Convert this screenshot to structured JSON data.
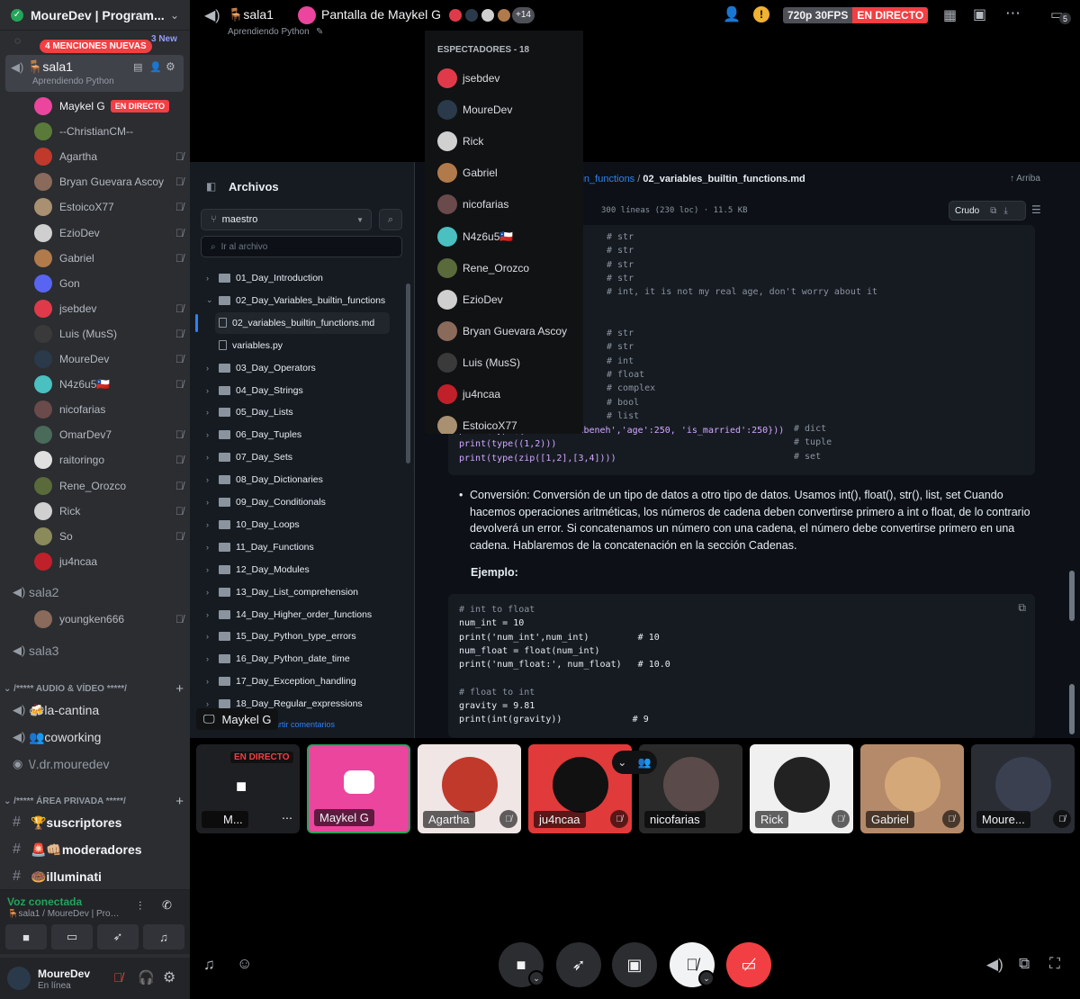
{
  "sidebar": {
    "server_name": "MoureDev | Program...",
    "mentions_badge": "4 MENCIONES NUEVAS",
    "new_badge": "3 New",
    "voice_channel": {
      "name": "sala1",
      "topic": "Aprendiendo Python"
    },
    "live_label": "EN DIRECTO",
    "users": [
      {
        "name": "Maykel G",
        "color": "#eb459e",
        "live": true,
        "muted": false
      },
      {
        "name": "--ChristianCM--",
        "color": "#5a7a3a",
        "live": false,
        "muted": false
      },
      {
        "name": "Agartha",
        "color": "#c0392b",
        "live": false,
        "muted": true
      },
      {
        "name": "Bryan Guevara Ascoy",
        "color": "#8a6a5a",
        "live": false,
        "muted": true
      },
      {
        "name": "EstoicoX77",
        "color": "#a89070",
        "live": false,
        "muted": true
      },
      {
        "name": "EzioDev",
        "color": "#cfcfcf",
        "live": false,
        "muted": true
      },
      {
        "name": "Gabriel",
        "color": "#b07a4a",
        "live": false,
        "muted": true
      },
      {
        "name": "Gon",
        "color": "#5865f2",
        "live": false,
        "muted": false
      },
      {
        "name": "jsebdev",
        "color": "#e03a4a",
        "live": false,
        "muted": true
      },
      {
        "name": "Luis (MusS)",
        "color": "#3a3a3a",
        "live": false,
        "muted": true
      },
      {
        "name": "MoureDev",
        "color": "#2a3a4a",
        "live": false,
        "muted": true
      },
      {
        "name": "N4z6u5🇨🇱",
        "color": "#4ac0c0",
        "live": false,
        "muted": true
      },
      {
        "name": "nicofarias",
        "color": "#6a4a4a",
        "live": false,
        "muted": false
      },
      {
        "name": "OmarDev7",
        "color": "#4a6a5a",
        "live": false,
        "muted": true
      },
      {
        "name": "raitoringo",
        "color": "#e0e0e0",
        "live": false,
        "muted": true
      },
      {
        "name": "Rene_Orozco",
        "color": "#5a6a3a",
        "live": false,
        "muted": true
      },
      {
        "name": "Rick",
        "color": "#d0d0d0",
        "live": false,
        "muted": true
      },
      {
        "name": "So",
        "color": "#8a8a5a",
        "live": false,
        "muted": true
      },
      {
        "name": "ju4ncaa",
        "color": "#c0202a",
        "live": false,
        "muted": false
      }
    ],
    "sala2": {
      "name": "sala2",
      "user": "youngken666"
    },
    "sala3": "sala3",
    "category_av": "/***** AUDIO & VÍDEO *****/",
    "av_channels": [
      "🍻la-cantina",
      "👥coworking",
      "\\/.dr.mouredev"
    ],
    "category_private": "/***** ÁREA PRIVADA *****/",
    "private_channels": [
      "🏆suscriptores",
      "🚨👊🏼moderadores",
      "🍩illuminati"
    ],
    "voice_connected": "Voz conectada",
    "voice_location": "🪑sala1 / MoureDev | Progr...",
    "user_name": "MoureDev",
    "user_status": "En línea"
  },
  "topbar": {
    "channel": "🪑sala1",
    "subtitle": "Aprendiendo Python",
    "stream_title": "Pantalla de Maykel G",
    "viewer_extra": "+14",
    "quality": "720p 30FPS",
    "live": "EN DIRECTO",
    "inbox_count": "5"
  },
  "viewers": {
    "header": "ESPECTADORES - 18",
    "list": [
      {
        "name": "jsebdev",
        "color": "#e03a4a"
      },
      {
        "name": "MoureDev",
        "color": "#2a3a4a"
      },
      {
        "name": "Rick",
        "color": "#d0d0d0"
      },
      {
        "name": "Gabriel",
        "color": "#b07a4a"
      },
      {
        "name": "nicofarias",
        "color": "#6a4a4a"
      },
      {
        "name": "N4z6u5🇨🇱",
        "color": "#4ac0c0"
      },
      {
        "name": "Rene_Orozco",
        "color": "#5a6a3a"
      },
      {
        "name": "EzioDev",
        "color": "#cfcfcf"
      },
      {
        "name": "Bryan Guevara Ascoy",
        "color": "#8a6a5a"
      },
      {
        "name": "Luis (MusS)",
        "color": "#3a3a3a"
      },
      {
        "name": "ju4ncaa",
        "color": "#c0202a"
      },
      {
        "name": "EstoicoX77",
        "color": "#a89070"
      }
    ]
  },
  "github": {
    "files_title": "Archivos",
    "branch": "maestro",
    "goto_placeholder": "Ir al archivo",
    "tree": [
      {
        "name": "01_Day_Introduction",
        "type": "folder",
        "depth": 0
      },
      {
        "name": "02_Day_Variables_builtin_functions",
        "type": "folder-open",
        "depth": 0
      },
      {
        "name": "02_variables_builtin_functions.md",
        "type": "file",
        "depth": 1,
        "selected": true
      },
      {
        "name": "variables.py",
        "type": "file",
        "depth": 1
      },
      {
        "name": "03_Day_Operators",
        "type": "folder",
        "depth": 0
      },
      {
        "name": "04_Day_Strings",
        "type": "folder",
        "depth": 0
      },
      {
        "name": "05_Day_Lists",
        "type": "folder",
        "depth": 0
      },
      {
        "name": "06_Day_Tuples",
        "type": "folder",
        "depth": 0
      },
      {
        "name": "07_Day_Sets",
        "type": "folder",
        "depth": 0
      },
      {
        "name": "08_Day_Dictionaries",
        "type": "folder",
        "depth": 0
      },
      {
        "name": "09_Day_Conditionals",
        "type": "folder",
        "depth": 0
      },
      {
        "name": "10_Day_Loops",
        "type": "folder",
        "depth": 0
      },
      {
        "name": "11_Day_Functions",
        "type": "folder",
        "depth": 0
      },
      {
        "name": "12_Day_Modules",
        "type": "folder",
        "depth": 0
      },
      {
        "name": "13_Day_List_comprehension",
        "type": "folder",
        "depth": 0
      },
      {
        "name": "14_Day_Higher_order_functions",
        "type": "folder",
        "depth": 0
      },
      {
        "name": "15_Day_Python_type_errors",
        "type": "folder",
        "depth": 0
      },
      {
        "name": "16_Day_Python_date_time",
        "type": "folder",
        "depth": 0
      },
      {
        "name": "17_Day_Exception_handling",
        "type": "folder",
        "depth": 0
      },
      {
        "name": "18_Day_Regular_expressions",
        "type": "folder",
        "depth": 0
      }
    ],
    "breadcrumb_link": "bles_builtin_functions",
    "breadcrumb_current": "02_variables_builtin_functions.md",
    "top_link": "Arriba",
    "file_info": "300 líneas (230 loc) · 11.5 KB",
    "tab_partial": "a",
    "raw": "Crudo",
    "code1_comments": [
      "# str",
      "# str",
      "# str",
      "# str",
      "# int, it is not my real age, don't worry about it",
      "",
      "",
      "# str",
      "# str",
      "# int",
      "# float",
      "# complex",
      "# bool",
      "# list"
    ],
    "code1_tail": [
      {
        "code": "print(type({'name':'Asabeneh','age':250, 'is_married':250}))",
        "comment": "# dict"
      },
      {
        "code": "print(type((1,2)))",
        "comment": "# tuple"
      },
      {
        "code": "print(type(zip([1,2],[3,4])))",
        "comment": "# set"
      }
    ],
    "prose": "Conversión: Conversión de un tipo de datos a otro tipo de datos. Usamos int(), float(), str(), list, set Cuando hacemos operaciones aritméticas, los números de cadena deben convertirse primero a int o float, de lo contrario devolverá un error. Si concatenamos un número con una cadena, el número debe convertirse primero en una cadena. Hablaremos de la concatenación en la sección Cadenas.",
    "example_label": "Ejemplo:",
    "code2": [
      "# int to float",
      "num_int = 10",
      "print('num_int',num_int)         # 10",
      "num_float = float(num_int)",
      "print('num_float:', num_float)   # 10.0",
      "",
      "# float to int",
      "gravity = 9.81",
      "print(int(gravity))             # 9"
    ],
    "bottom_link": "partir comentarios"
  },
  "stream": {
    "presenter": "Maykel G"
  },
  "tiles": [
    {
      "name": "M...",
      "bg": "#1e1f22",
      "kind": "screen",
      "live": "EN DIRECTO"
    },
    {
      "name": "Maykel G",
      "bg": "#eb459e",
      "kind": "discord"
    },
    {
      "name": "Agartha",
      "bg": "#f0e6e6",
      "kind": "avatar",
      "face": "#c0392b"
    },
    {
      "name": "ju4ncaa",
      "bg": "#e03a3a",
      "kind": "avatar",
      "face": "#111"
    },
    {
      "name": "nicofarias",
      "bg": "#2a2a2a",
      "kind": "avatar",
      "face": "#5a4a4a"
    },
    {
      "name": "Rick",
      "bg": "#f0f0f0",
      "kind": "avatar",
      "face": "#222"
    },
    {
      "name": "Gabriel",
      "bg": "#b48a6a",
      "kind": "avatar",
      "face": "#d4a878"
    },
    {
      "name": "Moure...",
      "bg": "#2a2d34",
      "kind": "avatar",
      "face": "#3a4050"
    }
  ]
}
